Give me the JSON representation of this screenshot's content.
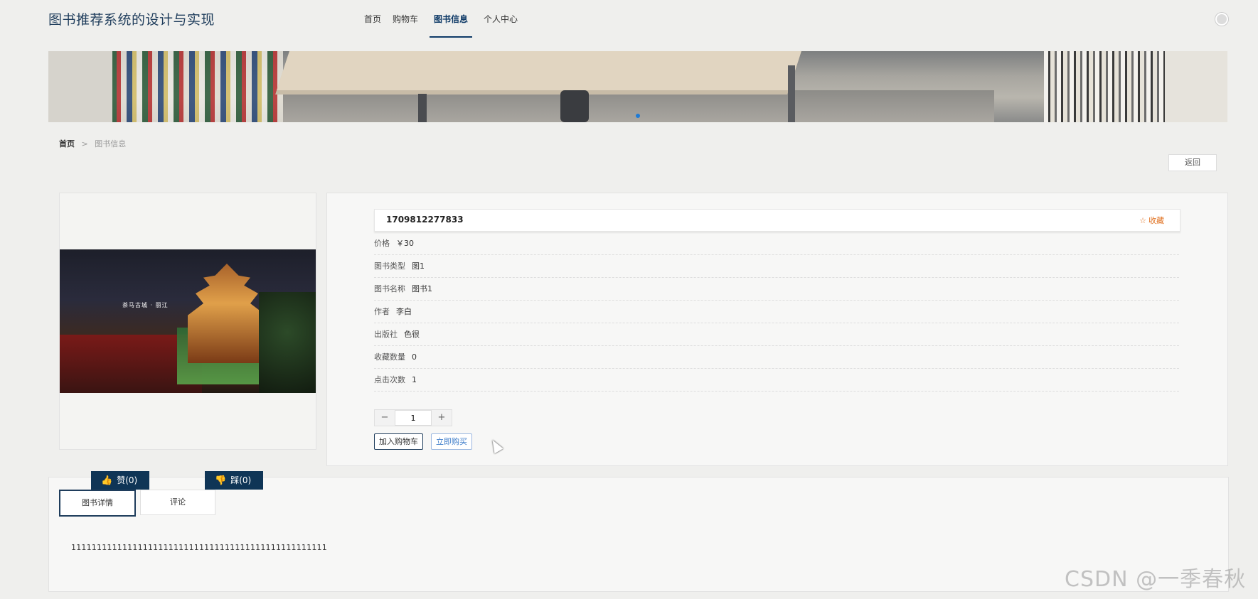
{
  "header": {
    "site_title": "图书推荐系统的设计与实现",
    "nav": [
      {
        "label": "首页",
        "active": false
      },
      {
        "label": "购物车",
        "active": false
      },
      {
        "label": "图书信息",
        "active": true
      },
      {
        "label": "个人中心",
        "active": false
      }
    ]
  },
  "breadcrumb": {
    "home": "首页",
    "separator": ">",
    "current": "图书信息"
  },
  "back_button": "返回",
  "book": {
    "title": "1709812277833",
    "favorite_label": "收藏",
    "image_caption": "茶马古城 · 丽江",
    "attributes": [
      {
        "label": "价格",
        "value": "￥30"
      },
      {
        "label": "图书类型",
        "value": "图1"
      },
      {
        "label": "图书名称",
        "value": "图书1"
      },
      {
        "label": "作者",
        "value": "李白"
      },
      {
        "label": "出版社",
        "value": "色很"
      },
      {
        "label": "收藏数量",
        "value": "0"
      },
      {
        "label": "点击次数",
        "value": "1"
      }
    ],
    "quantity": "1",
    "minus": "−",
    "plus": "+",
    "add_to_cart": "加入购物车",
    "buy_now": "立即购买"
  },
  "votes": {
    "like": "赞(0)",
    "dislike": "踩(0)"
  },
  "tabs": [
    {
      "label": "图书详情",
      "active": true
    },
    {
      "label": "评论",
      "active": false
    }
  ],
  "detail_text": "11111111111111111111111111111111111111111111111111",
  "watermark": "CSDN @一季春秋",
  "colors": {
    "primary": "#0f3556",
    "accent_orange": "#e0701f",
    "link_blue": "#3d7cc9",
    "background": "#efefed"
  }
}
